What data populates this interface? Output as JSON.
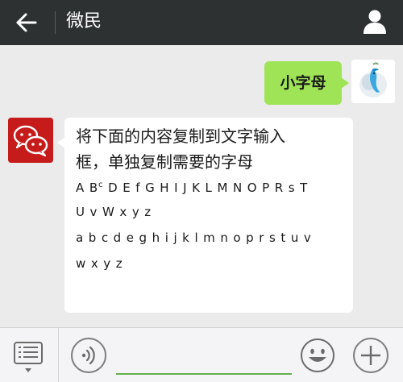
{
  "header": {
    "title": "微民",
    "back_icon": "back-arrow-icon",
    "profile_icon": "person-icon"
  },
  "messages": {
    "outgoing": {
      "text": "小字母"
    },
    "incoming": {
      "lines_cn": [
        "将下面的内容复制到文字输入",
        "框，单独复制需要的字母"
      ],
      "line_caps_a": "A B",
      "line_caps_sup": "c",
      "line_caps_b": " D E f G H I J K L  M N O P R s T",
      "line_caps_2": "U  v W x y z",
      "line_lower_1": "a b c d e g h i j k l m n o p  r s t u v",
      "line_lower_2": "w x y z"
    }
  },
  "bottombar": {
    "menu_icon": "menu-list-icon",
    "voice_icon": "voice-icon",
    "emoji_icon": "emoji-icon",
    "plus_icon": "plus-icon",
    "input_value": ""
  },
  "colors": {
    "header_bg": "#2e3132",
    "chat_bg": "#ebebeb",
    "outgoing_bubble": "#9fe356",
    "incoming_bubble": "#ffffff",
    "input_underline": "#62b04b",
    "avatar_red": "#c61b1b"
  }
}
